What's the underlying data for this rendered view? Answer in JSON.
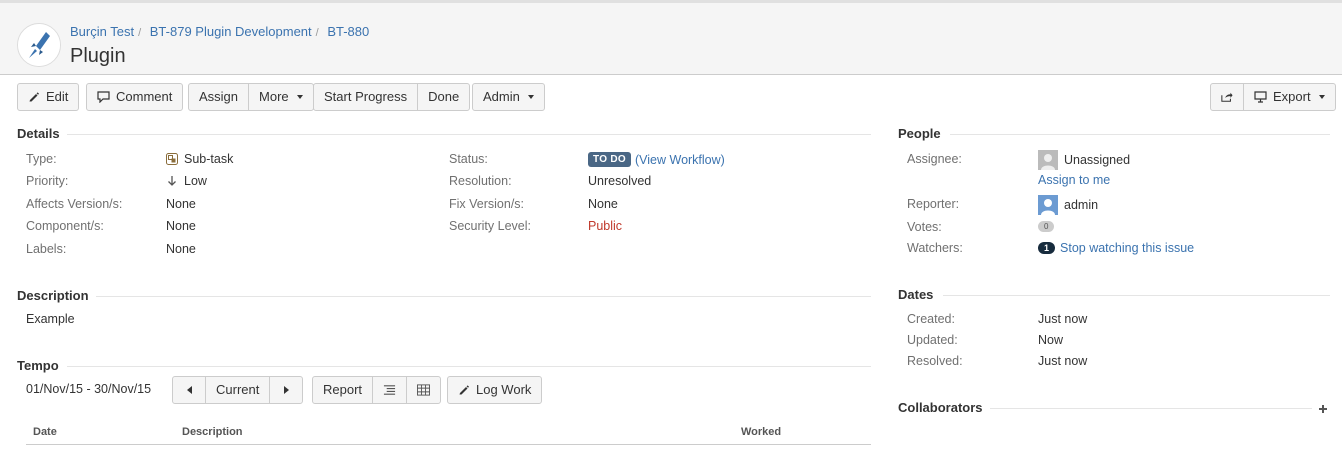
{
  "header": {
    "breadcrumbs": [
      "Burçin Test",
      "BT-879 Plugin Development",
      "BT-880"
    ],
    "title": "Plugin"
  },
  "toolbar": {
    "edit": "Edit",
    "comment": "Comment",
    "assign": "Assign",
    "more": "More",
    "start_progress": "Start Progress",
    "done": "Done",
    "admin": "Admin",
    "export": "Export"
  },
  "details": {
    "title": "Details",
    "type_label": "Type:",
    "type_value": "Sub-task",
    "priority_label": "Priority:",
    "priority_value": "Low",
    "affects_label": "Affects Version/s:",
    "affects_value": "None",
    "component_label": "Component/s:",
    "component_value": "None",
    "labels_label": "Labels:",
    "labels_value": "None",
    "status_label": "Status:",
    "status_value": "TO DO",
    "view_workflow": "View Workflow",
    "resolution_label": "Resolution:",
    "resolution_value": "Unresolved",
    "fix_label": "Fix Version/s:",
    "fix_value": "None",
    "security_label": "Security Level:",
    "security_value": "Public"
  },
  "description": {
    "title": "Description",
    "text": "Example"
  },
  "tempo": {
    "title": "Tempo",
    "range": "01/Nov/15 - 30/Nov/15",
    "current": "Current",
    "report": "Report",
    "log_work": "Log Work",
    "col_date": "Date",
    "col_description": "Description",
    "col_worked": "Worked"
  },
  "people": {
    "title": "People",
    "assignee_label": "Assignee:",
    "assignee_value": "Unassigned",
    "assign_to_me": "Assign to me",
    "reporter_label": "Reporter:",
    "reporter_value": "admin",
    "votes_label": "Votes:",
    "votes_value": "0",
    "watchers_label": "Watchers:",
    "watchers_count": "1",
    "stop_watching": "Stop watching this issue"
  },
  "dates": {
    "title": "Dates",
    "created_label": "Created:",
    "created_value": "Just now",
    "updated_label": "Updated:",
    "updated_value": "Now",
    "resolved_label": "Resolved:",
    "resolved_value": "Just now"
  },
  "collaborators": {
    "title": "Collaborators"
  },
  "colors": {
    "link": "#3b73af",
    "status_lozenge": "#4a6785",
    "security_public": "#c0392b"
  }
}
